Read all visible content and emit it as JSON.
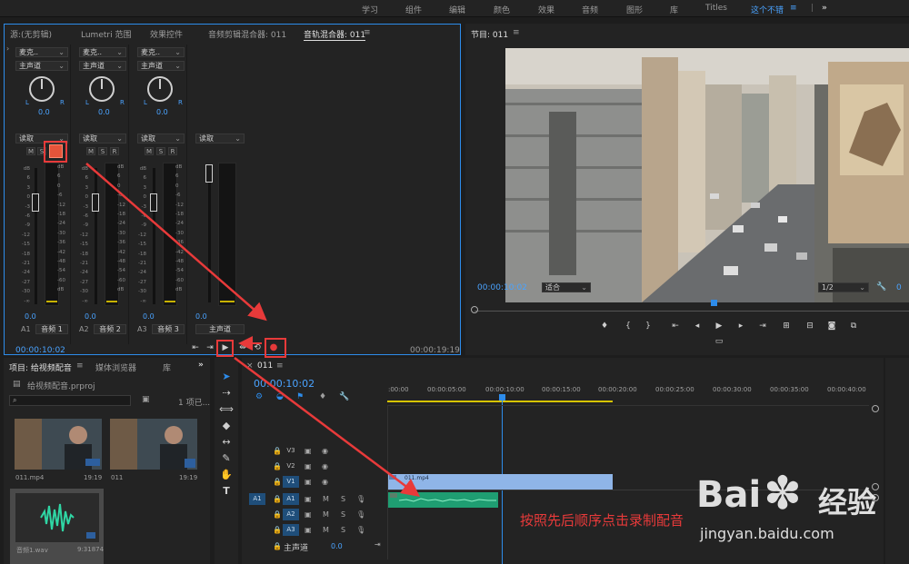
{
  "workspaces": {
    "items": [
      "学习",
      "组件",
      "编辑",
      "颜色",
      "效果",
      "音频",
      "图形",
      "库",
      "Titles",
      "这个不错"
    ],
    "active": "这个不错",
    "more": "»"
  },
  "source_panel": {
    "tabs": [
      "源:(无剪辑)",
      "Lumetri 范围",
      "效果控件",
      "音频剪辑混合器: 011",
      "音轨混合器: 011"
    ],
    "active_tab": "音轨混合器: 011",
    "menu_icon": "≡"
  },
  "mixer": {
    "channels": [
      {
        "input": "麦克..",
        "output": "主声道",
        "pan": "0.0",
        "L": "L",
        "R": "R",
        "auto": "读取",
        "m": "M",
        "s": "S",
        "r": "R",
        "vol": "0.0",
        "id": "A1",
        "name": "音频 1"
      },
      {
        "input": "麦克..",
        "output": "主声道",
        "pan": "0.0",
        "L": "L",
        "R": "R",
        "auto": "读取",
        "m": "M",
        "s": "S",
        "r": "R",
        "vol": "0.0",
        "id": "A2",
        "name": "音频 2"
      },
      {
        "input": "麦克..",
        "output": "主声道",
        "pan": "0.0",
        "L": "L",
        "R": "R",
        "auto": "读取",
        "m": "M",
        "s": "S",
        "r": "R",
        "vol": "0.0",
        "id": "A3",
        "name": "音频 3"
      }
    ],
    "master": {
      "auto": "读取",
      "vol": "0.0",
      "name": "主声道"
    },
    "scale": [
      "dB",
      "6",
      "0",
      "-6",
      "-12",
      "-18",
      "-24",
      "-30",
      "-36",
      "-42",
      "-48",
      "-54",
      "-60",
      "dB"
    ],
    "fader_scale": [
      "dB",
      "6",
      "3",
      "0",
      "-3",
      "-6",
      "-9",
      "-12",
      "-15",
      "-18",
      "-21",
      "-24",
      "-27",
      "-30",
      "-∞"
    ],
    "timecode_left": "00:00:10:02",
    "timecode_right": "00:00:19:19"
  },
  "program": {
    "title": "节目: 011",
    "menu_icon": "≡",
    "timecode": "00:00:10:02",
    "fit": "适合",
    "resolution": "1/2",
    "timecode_right": "0"
  },
  "project": {
    "tab_project": "项目: 给视频配音",
    "tab_browser": "媒体浏览器",
    "tab_library": "库",
    "more": "»",
    "file": "给视频配音.prproj",
    "count": "1 项已...",
    "search_placeholder": "",
    "items": [
      {
        "name": "011.mp4",
        "duration": "19:19"
      },
      {
        "name": "011",
        "duration": "19:19"
      },
      {
        "name": "音频1.wav",
        "duration": "9:31874"
      }
    ]
  },
  "timeline": {
    "tab": "011",
    "menu_icon": "≡",
    "close": "×",
    "timecode": "00:00:10:02",
    "ruler": [
      ":00:00",
      "00:00:05:00",
      "00:00:10:00",
      "00:00:15:00",
      "00:00:20:00",
      "00:00:25:00",
      "00:00:30:00",
      "00:00:35:00",
      "00:00:40:00"
    ],
    "tracks": [
      {
        "source": "",
        "label": "V3"
      },
      {
        "source": "",
        "label": "V2"
      },
      {
        "source": "",
        "label": "V1"
      },
      {
        "source": "A1",
        "label": "A1"
      },
      {
        "source": "",
        "label": "A2"
      },
      {
        "source": "",
        "label": "A3"
      }
    ],
    "master_label": "主声道",
    "master_value": "0.0",
    "video_clip": "011.mp4",
    "m": "M",
    "s": "S"
  },
  "annotation": "按照先后顺序点击录制配音",
  "watermark": {
    "brand": "Bai",
    "brand_cn": "经验",
    "url": "jingyan.baidu.com"
  },
  "colors": {
    "accent": "#2d8ceb",
    "timecode": "#4aa3ff",
    "highlight": "#e83a3a",
    "audio_clip": "#1f9e72",
    "video_clip": "#8fb5e8"
  }
}
